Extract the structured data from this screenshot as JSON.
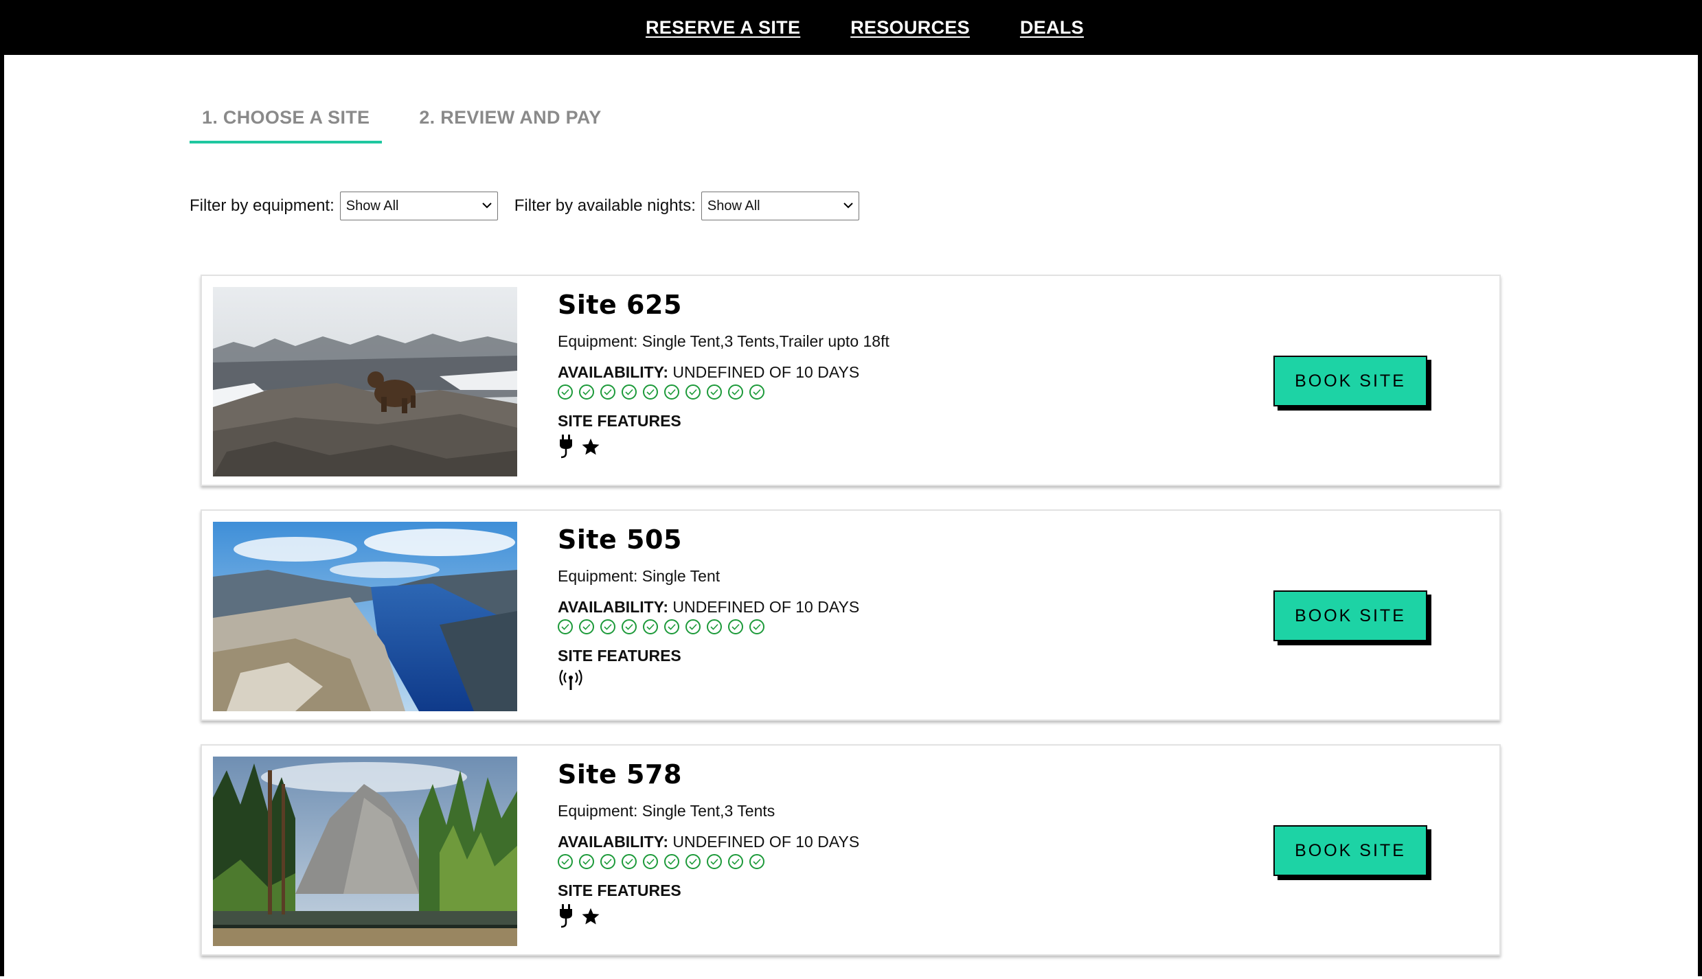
{
  "nav": {
    "items": [
      "RESERVE A SITE",
      "RESOURCES",
      "DEALS"
    ]
  },
  "steps": [
    "1. CHOOSE A SITE",
    "2. REVIEW AND PAY"
  ],
  "filters": {
    "equipment_label": "Filter by equipment:",
    "equipment_value": "Show All",
    "nights_label": "Filter by available nights:",
    "nights_value": "Show All"
  },
  "colors": {
    "accent": "#1dd3a5",
    "check": "#1d9a3a",
    "nav_bg": "#000000"
  },
  "sites": [
    {
      "name": "Site 625",
      "equipment": "Equipment: Single Tent,3 Tents,Trailer upto 18ft",
      "availability_label": "AVAILABILITY:",
      "availability_value": "UNDEFINED OF 10 DAYS",
      "features_title": "SITE FEATURES",
      "features": [
        "plug-icon",
        "star-icon"
      ],
      "button": "BOOK SITE",
      "photo": "bear-on-rocky-ridge"
    },
    {
      "name": "Site 505",
      "equipment": "Equipment: Single Tent",
      "availability_label": "AVAILABILITY:",
      "availability_value": "UNDEFINED OF 10 DAYS",
      "features_title": "SITE FEATURES",
      "features": [
        "wifi-signal-icon"
      ],
      "button": "BOOK SITE",
      "photo": "fjord-cliffs"
    },
    {
      "name": "Site 578",
      "equipment": "Equipment: Single Tent,3 Tents",
      "availability_label": "AVAILABILITY:",
      "availability_value": "UNDEFINED OF 10 DAYS",
      "features_title": "SITE FEATURES",
      "features": [
        "plug-icon",
        "star-icon"
      ],
      "button": "BOOK SITE",
      "photo": "yosemite-forest-river"
    }
  ]
}
